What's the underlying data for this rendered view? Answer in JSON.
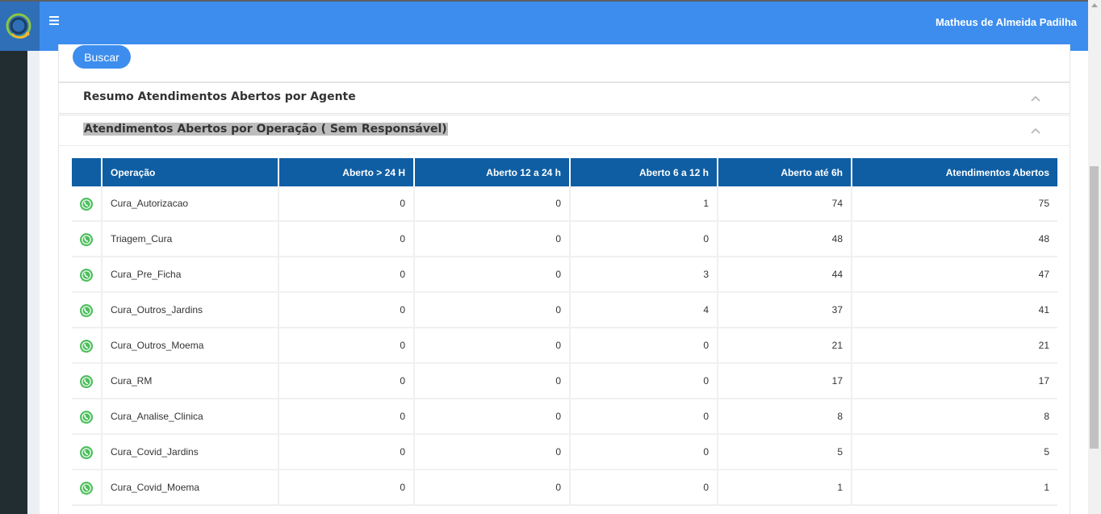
{
  "header": {
    "user_name": "Matheus de Almeida Padilha",
    "menu_icon": "hamburger-icon",
    "logo_icon": "headset-logo"
  },
  "search": {
    "button_label": "Buscar"
  },
  "sections": [
    {
      "title": "Resumo Atendimentos Abertos por Agente",
      "icon": "chevron-up-icon"
    },
    {
      "title": "Atendimentos Abertos por Operação ( Sem Responsável)",
      "icon": "chevron-up-icon"
    }
  ],
  "table": {
    "headers": [
      "Operação",
      "Aberto > 24 H",
      "Aberto 12 a 24 h",
      "Aberto 6 a 12 h",
      "Aberto até 6h",
      "Atendimentos Abertos"
    ],
    "channel_icon": "whatsapp-icon",
    "rows": [
      [
        "Cura_Autorizacao",
        "0",
        "0",
        "1",
        "74",
        "75"
      ],
      [
        "Triagem_Cura",
        "0",
        "0",
        "0",
        "48",
        "48"
      ],
      [
        "Cura_Pre_Ficha",
        "0",
        "0",
        "3",
        "44",
        "47"
      ],
      [
        "Cura_Outros_Jardins",
        "0",
        "0",
        "4",
        "37",
        "41"
      ],
      [
        "Cura_Outros_Moema",
        "0",
        "0",
        "0",
        "21",
        "21"
      ],
      [
        "Cura_RM",
        "0",
        "0",
        "0",
        "17",
        "17"
      ],
      [
        "Cura_Analise_Clinica",
        "0",
        "0",
        "0",
        "8",
        "8"
      ],
      [
        "Cura_Covid_Jardins",
        "0",
        "0",
        "0",
        "5",
        "5"
      ],
      [
        "Cura_Covid_Moema",
        "0",
        "0",
        "0",
        "1",
        "1"
      ]
    ]
  },
  "colors": {
    "topbar": "#3c8dee",
    "table_header": "#0f5ea3",
    "sidebar": "#222d32",
    "whatsapp": "#4cbf5c"
  }
}
